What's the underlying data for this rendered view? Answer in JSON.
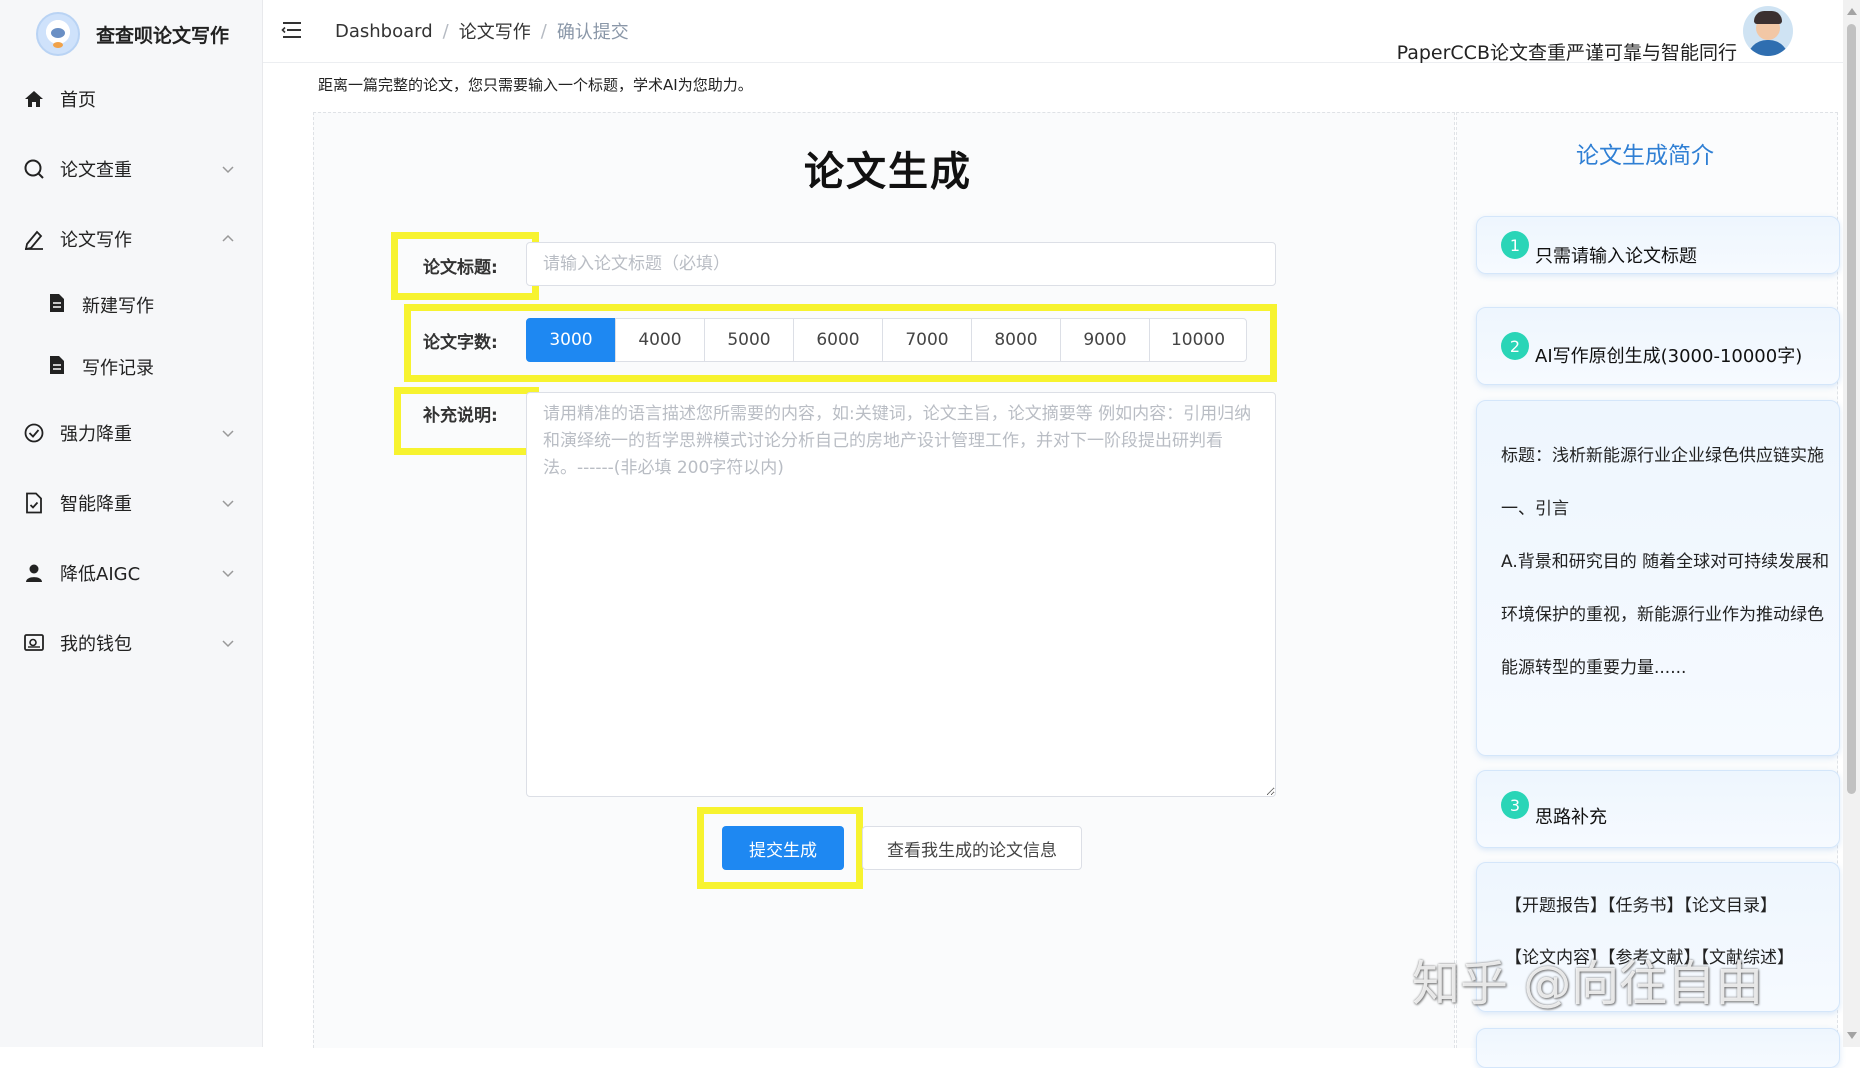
{
  "app": {
    "logo_text": "查查呗论文写作"
  },
  "sidebar": {
    "items": [
      {
        "label": "首页"
      },
      {
        "label": "论文查重"
      },
      {
        "label": "论文写作"
      },
      {
        "label": "强力降重"
      },
      {
        "label": "智能降重"
      },
      {
        "label": "降低AIGC"
      },
      {
        "label": "我的钱包"
      }
    ],
    "submenu": [
      {
        "label": "新建写作"
      },
      {
        "label": "写作记录"
      }
    ]
  },
  "header": {
    "breadcrumb": [
      "Dashboard",
      "论文写作",
      "确认提交"
    ],
    "breadcrumb_sep": "/",
    "slogan": "PaperCCB论文查重严谨可靠与智能同行"
  },
  "hint": "距离一篇完整的论文，您只需要输入一个标题，学术AI为您助力。",
  "form": {
    "title": "论文生成",
    "title_label": "论文标题:",
    "title_placeholder": "请输入论文标题（必填）",
    "title_value": "",
    "wordcount_label": "论文字数:",
    "wordcount_options": [
      "3000",
      "4000",
      "5000",
      "6000",
      "7000",
      "8000",
      "9000",
      "10000"
    ],
    "wordcount_selected": "3000",
    "extra_label": "补充说明:",
    "extra_placeholder": "请用精准的语言描述您所需要的内容，如:关键词，论文主旨，论文摘要等 例如内容：引用归纳和演绎统一的哲学思辨模式讨论分析自己的房地产设计管理工作，并对下一阶段提出研判看法。------(非必填 200字符以内)",
    "submit_label": "提交生成",
    "view_label": "查看我生成的论文信息"
  },
  "intro": {
    "title": "论文生成简介",
    "steps": [
      {
        "num": "1",
        "text": "只需请输入论文标题"
      },
      {
        "num": "2",
        "text": "AI写作原创生成(3000-10000字)"
      },
      {
        "num": "3",
        "text": "思路补充"
      }
    ],
    "sample_lines": [
      "标题：浅析新能源行业企业绿色供应链实施",
      "一、引言",
      "A.背景和研究目的 随着全球对可持续发展和",
      "环境保护的重视，新能源行业作为推动绿色",
      "能源转型的重要力量......"
    ],
    "tags_lines": [
      "【开题报告】【任务书】【论文目录】",
      "【论文内容】【参考文献】【文献综述】"
    ]
  },
  "watermark": "知乎 @向往自由",
  "colors": {
    "primary": "#1e88f2",
    "highlight": "#f7f32f",
    "step_badge": "#2ad5b7",
    "intro_title": "#2f7fd4"
  }
}
